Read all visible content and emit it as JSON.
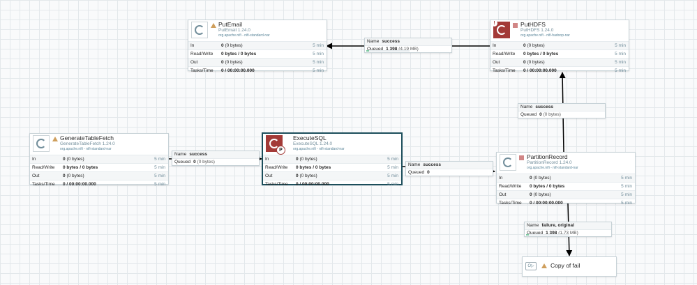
{
  "labels": {
    "in": "In",
    "read_write": "Read/Write",
    "out": "Out",
    "tasks_time": "Tasks/Time",
    "conn_name": "Name",
    "conn_queued": "Queued"
  },
  "processors": {
    "putemail": {
      "name": "PutEmail",
      "type": "PutEmail 1.24.0",
      "bundle": "org.apache.nifi - nifi-standard-nar",
      "status": "warning-icon",
      "in": "0",
      "in_bytes": "(0 bytes)",
      "rw": "0 bytes / 0 bytes",
      "out": "0",
      "out_bytes": "(0 bytes)",
      "tasks": "0 / 00:00:00.000",
      "window": "5 min"
    },
    "puthdfs": {
      "name": "PutHDFS",
      "type": "PutHDFS 1.24.0",
      "bundle": "org.apache.nifi - nifi-hadoop-nar",
      "status": "stopped-icon",
      "in": "0",
      "in_bytes": "(0 bytes)",
      "rw": "0 bytes / 0 bytes",
      "out": "0",
      "out_bytes": "(0 bytes)",
      "tasks": "0 / 00:00:00.000",
      "window": "5 min"
    },
    "generatetablefetch": {
      "name": "GenerateTableFetch",
      "type": "GenerateTableFetch 1.24.0",
      "bundle": "org.apache.nifi - nifi-standard-nar",
      "status": "warning-icon",
      "in": "0",
      "in_bytes": "(0 bytes)",
      "rw": "0 bytes / 0 bytes",
      "out": "0",
      "out_bytes": "(0 bytes)",
      "tasks": "0 / 00:00:00.000",
      "window": "5 min"
    },
    "executesql": {
      "name": "ExecuteSQL",
      "type": "ExecuteSQL 1.24.0",
      "bundle": "org.apache.nifi - nifi-standard-nar",
      "status": "primary-node-icon",
      "badge": "P",
      "in": "0",
      "in_bytes": "(0 bytes)",
      "rw": "0 bytes / 0 bytes",
      "out": "0",
      "out_bytes": "(0 bytes)",
      "tasks": "0 / 00:00:00.000",
      "window": "5 min"
    },
    "partitionrecord": {
      "name": "PartitionRecord",
      "type": "PartitionRecord 1.24.0",
      "bundle": "org.apache.nifi - nifi-standard-nar",
      "status": "stopped-icon",
      "in": "0",
      "in_bytes": "(0 bytes)",
      "rw": "0 bytes / 0 bytes",
      "out": "0",
      "out_bytes": "(0 bytes)",
      "tasks": "0 / 00:00:00.000",
      "window": "5 min"
    }
  },
  "connections": {
    "hdfs_to_email": {
      "name": "success",
      "queued": "1 398",
      "queued_size": "(4,19 MB)"
    },
    "partition_to_hdfs": {
      "name": "success",
      "queued": "0",
      "queued_size": "(0 bytes)"
    },
    "gtf_to_exec": {
      "name": "success",
      "queued": "0",
      "queued_size": "(0 bytes)"
    },
    "exec_to_partition": {
      "name": "success",
      "queued": "0",
      "queued_size": ""
    },
    "partition_to_funnel": {
      "name": "failure, original",
      "queued": "1 398",
      "queued_size": "(1,73 MB)"
    }
  },
  "funnel": {
    "name": "Copy of fail",
    "icon": "output-port-icon",
    "icon_text": "O▷"
  },
  "colors": {
    "canvas": "#f9fafb",
    "grid": "#e3e8eb",
    "invalid_red": "#a33a37",
    "warning": "#cf9f5d",
    "stopped": "#d18686",
    "selected_border": "#1c4e5b",
    "queue_bar": "#7dc7a0"
  }
}
